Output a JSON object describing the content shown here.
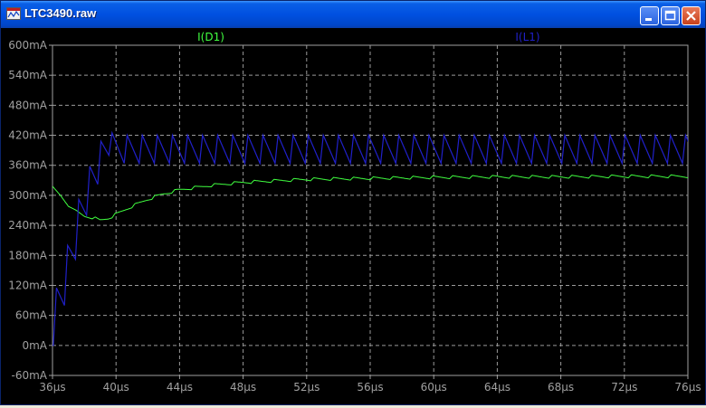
{
  "window": {
    "title": "LTC3490.raw",
    "icon": "waveform-icon",
    "buttons": [
      "minimize-icon",
      "maximize-icon",
      "close-icon"
    ]
  },
  "colors": {
    "background": "#000000",
    "axis": "#a0a0a0",
    "grid": "#9a9a9a",
    "i_d1": "#40ff40",
    "i_l1": "#2020c8"
  },
  "chart_data": {
    "type": "line",
    "title": "",
    "xlabel": "",
    "ylabel": "",
    "xlim": [
      36,
      76
    ],
    "ylim": [
      -60,
      600
    ],
    "x_unit": "µs",
    "y_unit": "mA",
    "grid": true,
    "x_ticks": [
      "36µs",
      "40µs",
      "44µs",
      "48µs",
      "52µs",
      "56µs",
      "60µs",
      "64µs",
      "68µs",
      "72µs",
      "76µs"
    ],
    "y_ticks": [
      "600mA",
      "540mA",
      "480mA",
      "420mA",
      "360mA",
      "300mA",
      "240mA",
      "180mA",
      "120mA",
      "60mA",
      "0mA",
      "-60mA"
    ],
    "legend": "top",
    "series": [
      {
        "name": "I(D1)",
        "x": [
          36.0,
          36.5,
          37.0,
          37.5,
          38.0,
          38.5,
          39.0,
          39.5,
          40.0,
          41.0,
          42.0,
          43.0,
          44.0,
          46.0,
          48.0,
          50.0,
          52.0,
          54.0,
          56.0,
          58.0,
          60.0,
          64.0,
          68.0,
          72.0,
          76.0
        ],
        "y": [
          318,
          300,
          278,
          270,
          258,
          256,
          250,
          254,
          262,
          278,
          292,
          303,
          311,
          320,
          326,
          329,
          332,
          333,
          334,
          335,
          336,
          337,
          337,
          338,
          338
        ],
        "ripple": 6,
        "period": 1.25
      },
      {
        "name": "I(L1)",
        "x": [
          36.0,
          36.05,
          36.25,
          36.75,
          36.95,
          37.45,
          37.65,
          38.15,
          38.35,
          38.85,
          39.05,
          39.55,
          39.75
        ],
        "y": [
          0,
          0,
          115,
          80,
          200,
          172,
          292,
          260,
          358,
          322,
          408,
          380,
          425
        ],
        "steady_high": 420,
        "steady_low": 364,
        "period": 0.95
      }
    ]
  }
}
